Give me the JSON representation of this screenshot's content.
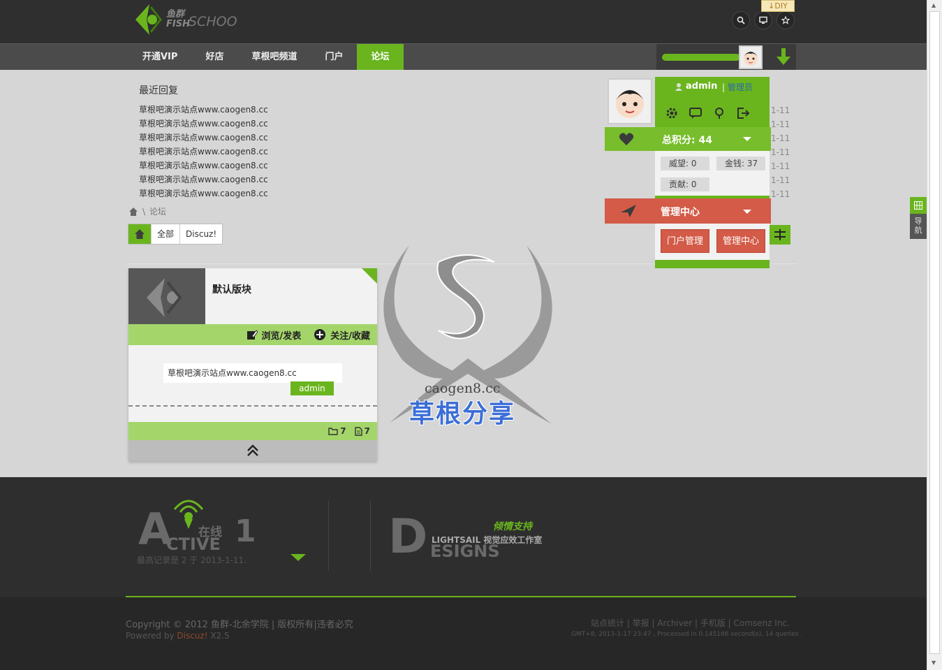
{
  "header": {
    "logo_fish": "鱼群",
    "logo_fish2": "FISH",
    "logo_school": "SCHOO",
    "diy_label": "DIY",
    "icons": [
      "search-icon",
      "monitor-icon",
      "star-icon"
    ]
  },
  "nav": {
    "items": [
      {
        "label": "开通VIP"
      },
      {
        "label": "好店"
      },
      {
        "label": "草根吧频道"
      },
      {
        "label": "门户"
      },
      {
        "label": "论坛"
      }
    ],
    "active_index": 4
  },
  "recent": {
    "title": "最近回复",
    "items": [
      "草根吧演示站点www.caogen8.cc",
      "草根吧演示站点www.caogen8.cc",
      "草根吧演示站点www.caogen8.cc",
      "草根吧演示站点www.caogen8.cc",
      "草根吧演示站点www.caogen8.cc",
      "草根吧演示站点www.caogen8.cc",
      "草根吧演示站点www.caogen8.cc"
    ],
    "dates": [
      "1-11",
      "1-11",
      "1-11",
      "1-11",
      "1-11",
      "1-11",
      "1-11"
    ]
  },
  "breadcrumb": {
    "sep": "\\",
    "current": "论坛"
  },
  "filter": {
    "items": [
      "全部",
      "Discuz!"
    ]
  },
  "forum_card": {
    "name": "默认版块",
    "action_browse": "浏览/发表",
    "action_follow": "关注/收藏",
    "latest_post": "草根吧演示站点www.caogen8.cc",
    "latest_user": "admin",
    "threads": "7",
    "posts": "7"
  },
  "user_panel": {
    "username": "admin",
    "role_sep": "|",
    "role": "管理员",
    "total_score_label": "总积分: 44",
    "prestige": "威望: 0",
    "money": "金钱: 37",
    "contribution": "贡献: 0",
    "admin_center_label": "管理中心",
    "btn_portal": "门户管理",
    "btn_admin": "管理中心"
  },
  "side_tab": {
    "label": "导航"
  },
  "footer": {
    "active_big": "A",
    "active_small": "CTIVE",
    "online_label": "在线",
    "online_count": "1",
    "record_text": "最高记录是  2 于  2013-1-11.",
    "design_big": "D",
    "design_small": "ESIGNS",
    "support": "倾情支持",
    "lightsail": "LIGHTSAIL 视觉应效工作室",
    "copyright": "Copyright © 2012 鱼群-北余学院  | 版权所有|违者必究",
    "powered_prefix": "Powered by ",
    "powered_name": "Discuz!",
    "powered_version": " X2.5",
    "links": "站点统计  |  举报  |  Archiver  |  手机版  |  Comsenz Inc.",
    "gmt": "GMT+8, 2013-1-17 23:47 , Processed in 0.145166 second(s), 14 queries ."
  },
  "watermark": {
    "site": "caogen8.cc",
    "name": "草根分享"
  },
  "colors": {
    "accent_green": "#6ab51e",
    "light_green": "#a4d56a",
    "manage_red": "#d35b48",
    "header_dark": "#2f2f2f",
    "link_blue": "#2c6aa6"
  }
}
